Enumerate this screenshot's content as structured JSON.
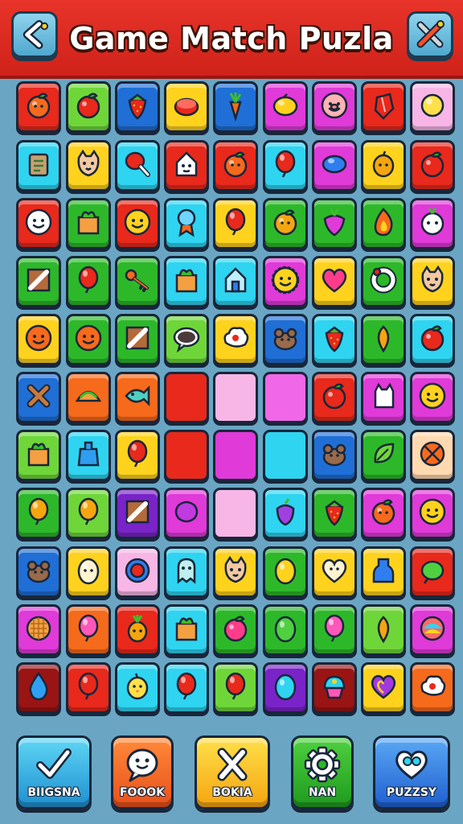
{
  "header": {
    "title": "Game Match Puzla",
    "back_icon": "back-arrow-icon",
    "tools_icon": "tools-icon"
  },
  "colors": {
    "header": "#e8342a",
    "background": "#6aa6c4",
    "tile_red": "#e8291c",
    "tile_green": "#3cbf2a",
    "tile_blue": "#1f6fd6",
    "tile_yellow": "#ffd21e",
    "tile_cyan": "#2fd4f0",
    "tile_magenta": "#e03ad8",
    "tile_pink": "#f7b6e6",
    "tile_orange": "#f66a1c"
  },
  "board": {
    "rows": [
      [
        {
          "c": "red",
          "i": "orange"
        },
        {
          "c": "lime",
          "i": "apple"
        },
        {
          "c": "blue",
          "i": "strawberry"
        },
        {
          "c": "yellow",
          "i": "button"
        },
        {
          "c": "blue",
          "i": "carrot"
        },
        {
          "c": "magenta",
          "i": "lemon"
        },
        {
          "c": "magenta",
          "i": "pig-face"
        },
        {
          "c": "red",
          "i": "gem"
        },
        {
          "c": "pink",
          "i": "ball"
        }
      ],
      [
        {
          "c": "cyan",
          "i": "scroll"
        },
        {
          "c": "yellow",
          "i": "cat-face"
        },
        {
          "c": "cyan",
          "i": "drumstick"
        },
        {
          "c": "red",
          "i": "house-face"
        },
        {
          "c": "red",
          "i": "orange"
        },
        {
          "c": "cyan",
          "i": "balloon"
        },
        {
          "c": "magenta",
          "i": "gem-blue"
        },
        {
          "c": "yellow",
          "i": "fruit-face"
        },
        {
          "c": "red",
          "i": "apple"
        }
      ],
      [
        {
          "c": "red",
          "i": "smiley-white"
        },
        {
          "c": "green",
          "i": "crate"
        },
        {
          "c": "red",
          "i": "smiley-yellow"
        },
        {
          "c": "cyan",
          "i": "medal"
        },
        {
          "c": "yellow",
          "i": "balloon-red"
        },
        {
          "c": "green",
          "i": "orange-face"
        },
        {
          "c": "green",
          "i": "radish"
        },
        {
          "c": "green",
          "i": "flame"
        },
        {
          "c": "magenta",
          "i": "onion-face"
        }
      ],
      [
        {
          "c": "green",
          "i": "ruler"
        },
        {
          "c": "green",
          "i": "balloon-red"
        },
        {
          "c": "green",
          "i": "key"
        },
        {
          "c": "cyan",
          "i": "crate"
        },
        {
          "c": "cyan",
          "i": "house"
        },
        {
          "c": "magenta",
          "i": "sun-face"
        },
        {
          "c": "yellow",
          "i": "heart"
        },
        {
          "c": "green",
          "i": "ring"
        },
        {
          "c": "yellow",
          "i": "cat-face"
        }
      ],
      [
        {
          "c": "yellow",
          "i": "smiley-orange"
        },
        {
          "c": "green",
          "i": "smiley-orange"
        },
        {
          "c": "green",
          "i": "ruler"
        },
        {
          "c": "lime",
          "i": "bubble"
        },
        {
          "c": "yellow",
          "i": "cloud-face"
        },
        {
          "c": "blue",
          "i": "bear"
        },
        {
          "c": "cyan",
          "i": "strawberry"
        },
        {
          "c": "green",
          "i": "lemon-orange"
        },
        {
          "c": "cyan",
          "i": "apple"
        }
      ],
      [
        {
          "c": "blue",
          "i": "cross"
        },
        {
          "c": "orange",
          "i": "taco"
        },
        {
          "c": "orange",
          "i": "fish"
        },
        {
          "c": "red",
          "i": ""
        },
        {
          "c": "pink",
          "i": ""
        },
        {
          "c": "magenta-light",
          "i": ""
        },
        {
          "c": "red",
          "i": "apple"
        },
        {
          "c": "magenta",
          "i": "cat-white"
        },
        {
          "c": "magenta",
          "i": "smiley-yellow"
        }
      ],
      [
        {
          "c": "lime",
          "i": "crate"
        },
        {
          "c": "cyan",
          "i": "bag"
        },
        {
          "c": "yellow",
          "i": "balloon-red"
        },
        {
          "c": "red",
          "i": ""
        },
        {
          "c": "magenta",
          "i": ""
        },
        {
          "c": "cyan",
          "i": ""
        },
        {
          "c": "blue",
          "i": "bear"
        },
        {
          "c": "green",
          "i": "leaf"
        },
        {
          "c": "peach",
          "i": "ball-orange"
        }
      ],
      [
        {
          "c": "green",
          "i": "balloon-orange"
        },
        {
          "c": "lime",
          "i": "balloon-orange"
        },
        {
          "c": "purple",
          "i": "ruler"
        },
        {
          "c": "magenta",
          "i": "blob"
        },
        {
          "c": "pink",
          "i": ""
        },
        {
          "c": "cyan",
          "i": "grapes"
        },
        {
          "c": "green",
          "i": "strawberry"
        },
        {
          "c": "magenta",
          "i": "orange"
        },
        {
          "c": "magenta",
          "i": "smiley-yellow"
        }
      ],
      [
        {
          "c": "blue",
          "i": "bear"
        },
        {
          "c": "yellow",
          "i": "egg-face"
        },
        {
          "c": "pink",
          "i": "donut"
        },
        {
          "c": "cyan",
          "i": "ghost"
        },
        {
          "c": "yellow",
          "i": "cat-face"
        },
        {
          "c": "green",
          "i": "egg-yellow"
        },
        {
          "c": "yellow",
          "i": "heart-white"
        },
        {
          "c": "yellow",
          "i": "bottle"
        },
        {
          "c": "red",
          "i": "leaf-green"
        }
      ],
      [
        {
          "c": "magenta",
          "i": "waffle"
        },
        {
          "c": "orange",
          "i": "balloon-pink"
        },
        {
          "c": "red",
          "i": "pineapple"
        },
        {
          "c": "cyan",
          "i": "crate"
        },
        {
          "c": "green",
          "i": "apple-pink"
        },
        {
          "c": "green",
          "i": "egg-green"
        },
        {
          "c": "green",
          "i": "balloon-pink"
        },
        {
          "c": "lime",
          "i": "lemon-orange"
        },
        {
          "c": "magenta",
          "i": "candy"
        }
      ],
      [
        {
          "c": "maroon",
          "i": "drop"
        },
        {
          "c": "red",
          "i": "balloon-red"
        },
        {
          "c": "cyan",
          "i": "chick"
        },
        {
          "c": "cyan",
          "i": "balloon-red"
        },
        {
          "c": "lime",
          "i": "balloon-red"
        },
        {
          "c": "purple",
          "i": "egg-cyan"
        },
        {
          "c": "maroon",
          "i": "cupcake"
        },
        {
          "c": "yellow",
          "i": "heart-purple"
        },
        {
          "c": "orange",
          "i": "cloud-face"
        }
      ]
    ]
  },
  "bottom_bar": {
    "buttons": [
      {
        "label": "BIIGSNA",
        "icon": "check-icon",
        "color": "cyan"
      },
      {
        "label": "FOOOK",
        "icon": "speech-bubble-icon",
        "color": "orange"
      },
      {
        "label": "BOKIA",
        "icon": "cross-icon",
        "color": "yellow"
      },
      {
        "label": "NAN",
        "icon": "gear-icon",
        "color": "green"
      },
      {
        "label": "PUZZSY",
        "icon": "heart-icon",
        "color": "blue"
      }
    ]
  }
}
